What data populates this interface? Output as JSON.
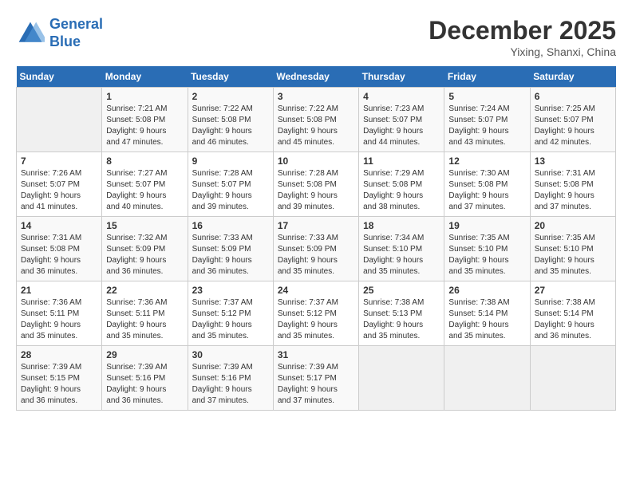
{
  "header": {
    "logo_line1": "General",
    "logo_line2": "Blue",
    "month_title": "December 2025",
    "location": "Yixing, Shanxi, China"
  },
  "days_of_week": [
    "Sunday",
    "Monday",
    "Tuesday",
    "Wednesday",
    "Thursday",
    "Friday",
    "Saturday"
  ],
  "weeks": [
    [
      {
        "day": "",
        "info": ""
      },
      {
        "day": "1",
        "info": "Sunrise: 7:21 AM\nSunset: 5:08 PM\nDaylight: 9 hours\nand 47 minutes."
      },
      {
        "day": "2",
        "info": "Sunrise: 7:22 AM\nSunset: 5:08 PM\nDaylight: 9 hours\nand 46 minutes."
      },
      {
        "day": "3",
        "info": "Sunrise: 7:22 AM\nSunset: 5:08 PM\nDaylight: 9 hours\nand 45 minutes."
      },
      {
        "day": "4",
        "info": "Sunrise: 7:23 AM\nSunset: 5:07 PM\nDaylight: 9 hours\nand 44 minutes."
      },
      {
        "day": "5",
        "info": "Sunrise: 7:24 AM\nSunset: 5:07 PM\nDaylight: 9 hours\nand 43 minutes."
      },
      {
        "day": "6",
        "info": "Sunrise: 7:25 AM\nSunset: 5:07 PM\nDaylight: 9 hours\nand 42 minutes."
      }
    ],
    [
      {
        "day": "7",
        "info": "Sunrise: 7:26 AM\nSunset: 5:07 PM\nDaylight: 9 hours\nand 41 minutes."
      },
      {
        "day": "8",
        "info": "Sunrise: 7:27 AM\nSunset: 5:07 PM\nDaylight: 9 hours\nand 40 minutes."
      },
      {
        "day": "9",
        "info": "Sunrise: 7:28 AM\nSunset: 5:07 PM\nDaylight: 9 hours\nand 39 minutes."
      },
      {
        "day": "10",
        "info": "Sunrise: 7:28 AM\nSunset: 5:08 PM\nDaylight: 9 hours\nand 39 minutes."
      },
      {
        "day": "11",
        "info": "Sunrise: 7:29 AM\nSunset: 5:08 PM\nDaylight: 9 hours\nand 38 minutes."
      },
      {
        "day": "12",
        "info": "Sunrise: 7:30 AM\nSunset: 5:08 PM\nDaylight: 9 hours\nand 37 minutes."
      },
      {
        "day": "13",
        "info": "Sunrise: 7:31 AM\nSunset: 5:08 PM\nDaylight: 9 hours\nand 37 minutes."
      }
    ],
    [
      {
        "day": "14",
        "info": "Sunrise: 7:31 AM\nSunset: 5:08 PM\nDaylight: 9 hours\nand 36 minutes."
      },
      {
        "day": "15",
        "info": "Sunrise: 7:32 AM\nSunset: 5:09 PM\nDaylight: 9 hours\nand 36 minutes."
      },
      {
        "day": "16",
        "info": "Sunrise: 7:33 AM\nSunset: 5:09 PM\nDaylight: 9 hours\nand 36 minutes."
      },
      {
        "day": "17",
        "info": "Sunrise: 7:33 AM\nSunset: 5:09 PM\nDaylight: 9 hours\nand 35 minutes."
      },
      {
        "day": "18",
        "info": "Sunrise: 7:34 AM\nSunset: 5:10 PM\nDaylight: 9 hours\nand 35 minutes."
      },
      {
        "day": "19",
        "info": "Sunrise: 7:35 AM\nSunset: 5:10 PM\nDaylight: 9 hours\nand 35 minutes."
      },
      {
        "day": "20",
        "info": "Sunrise: 7:35 AM\nSunset: 5:10 PM\nDaylight: 9 hours\nand 35 minutes."
      }
    ],
    [
      {
        "day": "21",
        "info": "Sunrise: 7:36 AM\nSunset: 5:11 PM\nDaylight: 9 hours\nand 35 minutes."
      },
      {
        "day": "22",
        "info": "Sunrise: 7:36 AM\nSunset: 5:11 PM\nDaylight: 9 hours\nand 35 minutes."
      },
      {
        "day": "23",
        "info": "Sunrise: 7:37 AM\nSunset: 5:12 PM\nDaylight: 9 hours\nand 35 minutes."
      },
      {
        "day": "24",
        "info": "Sunrise: 7:37 AM\nSunset: 5:12 PM\nDaylight: 9 hours\nand 35 minutes."
      },
      {
        "day": "25",
        "info": "Sunrise: 7:38 AM\nSunset: 5:13 PM\nDaylight: 9 hours\nand 35 minutes."
      },
      {
        "day": "26",
        "info": "Sunrise: 7:38 AM\nSunset: 5:14 PM\nDaylight: 9 hours\nand 35 minutes."
      },
      {
        "day": "27",
        "info": "Sunrise: 7:38 AM\nSunset: 5:14 PM\nDaylight: 9 hours\nand 36 minutes."
      }
    ],
    [
      {
        "day": "28",
        "info": "Sunrise: 7:39 AM\nSunset: 5:15 PM\nDaylight: 9 hours\nand 36 minutes."
      },
      {
        "day": "29",
        "info": "Sunrise: 7:39 AM\nSunset: 5:16 PM\nDaylight: 9 hours\nand 36 minutes."
      },
      {
        "day": "30",
        "info": "Sunrise: 7:39 AM\nSunset: 5:16 PM\nDaylight: 9 hours\nand 37 minutes."
      },
      {
        "day": "31",
        "info": "Sunrise: 7:39 AM\nSunset: 5:17 PM\nDaylight: 9 hours\nand 37 minutes."
      },
      {
        "day": "",
        "info": ""
      },
      {
        "day": "",
        "info": ""
      },
      {
        "day": "",
        "info": ""
      }
    ]
  ]
}
